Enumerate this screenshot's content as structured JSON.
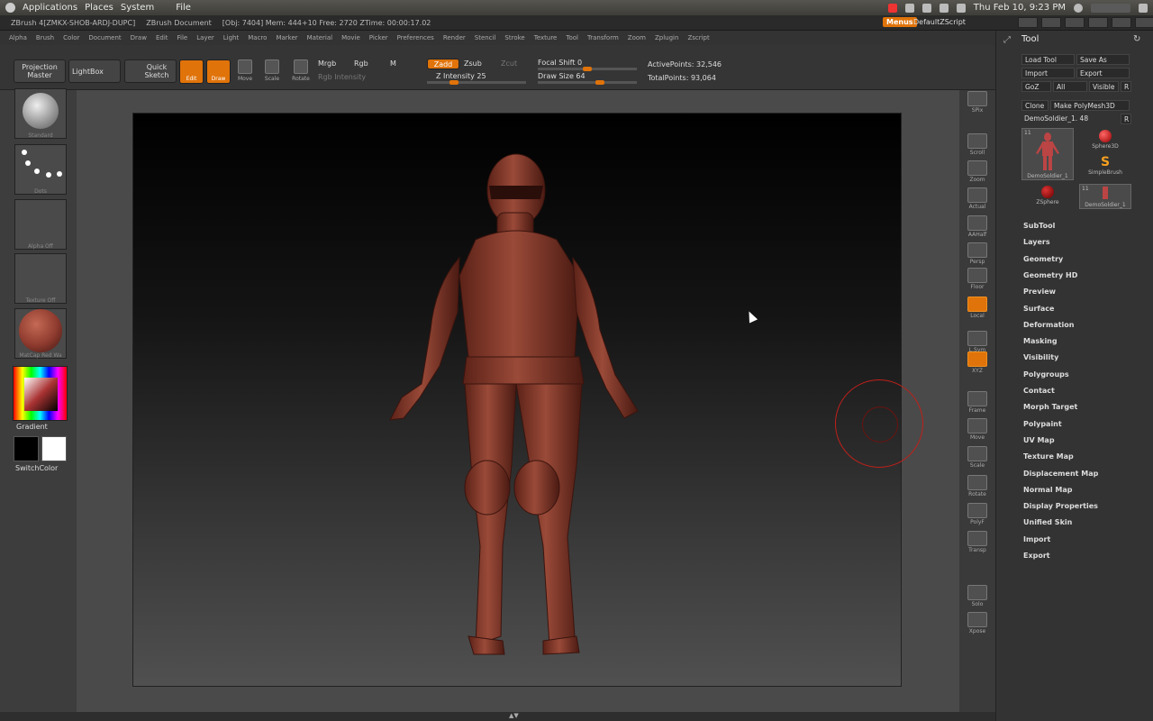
{
  "system_bar": {
    "menus": [
      "Applications",
      "Places",
      "System",
      "File"
    ],
    "clock": "Thu Feb 10,  9:23 PM"
  },
  "title_bar": {
    "app": "ZBrush 4[ZMKX-SHOB-ARDJ-DUPC]",
    "document": "ZBrush Document",
    "stats": "[Obj: 7404] Mem: 444+10 Free: 2720 ZTime: 00:00:17.02",
    "menus_button": "Menus",
    "script": "DefaultZScript"
  },
  "menu_items": [
    "Alpha",
    "Brush",
    "Color",
    "Document",
    "Draw",
    "Edit",
    "File",
    "Layer",
    "Light",
    "Macro",
    "Marker",
    "Material",
    "Movie",
    "Picker",
    "Preferences",
    "Render",
    "Stencil",
    "Stroke",
    "Texture",
    "Tool",
    "Transform",
    "Zoom",
    "Zplugin",
    "Zscript"
  ],
  "toolbar": {
    "projection_master": "Projection Master",
    "lightbox": "LightBox",
    "quick_sketch": "Quick Sketch",
    "edit": "Edit",
    "draw": "Draw",
    "move": "Move",
    "scale": "Scale",
    "rotate": "Rotate",
    "mrgb": "Mrgb",
    "rgb": "Rgb",
    "m": "M",
    "zadd": "Zadd",
    "zsub": "Zsub",
    "zcut": "Zcut",
    "rgb_intensity": "Rgb Intensity",
    "z_intensity": "Z Intensity 25",
    "focal_shift": "Focal Shift 0",
    "draw_size": "Draw Size 64",
    "active_points": "ActivePoints: 32,546",
    "total_points": "TotalPoints: 93,064"
  },
  "left_shelf": {
    "brush": "Standard",
    "stroke": "Dots",
    "alpha": "Alpha Off",
    "texture": "Texture Off",
    "material": "MatCap Red Wa",
    "gradient": "Gradient",
    "switch_color": "SwitchColor"
  },
  "right_shelf": [
    "SPix",
    "Scroll",
    "Zoom",
    "Actual",
    "AAHalf",
    "Persp",
    "Floor",
    "Local",
    "L.Sym",
    "XYZ",
    "Frame",
    "Move",
    "Scale",
    "Rotate",
    "PolyF",
    "Transp",
    "Solo",
    "Xpose"
  ],
  "tool_palette": {
    "title": "Tool",
    "buttons": [
      "Load Tool",
      "Save As",
      "Import",
      "Export",
      "GoZ",
      "All",
      "Visible",
      "R",
      "Clone",
      "Make PolyMesh3D"
    ],
    "current_tool": "DemoSoldier_1. 48",
    "thumbs": [
      "DemoSoldier_1",
      "Sphere3D",
      "SimpleBrush",
      "ZSphere",
      "DemoSoldier_1"
    ],
    "thumb_counts": [
      "11",
      "11"
    ],
    "subpalettes": [
      "SubTool",
      "Layers",
      "Geometry",
      "Geometry HD",
      "Preview",
      "Surface",
      "Deformation",
      "Masking",
      "Visibility",
      "Polygroups",
      "Contact",
      "Morph Target",
      "Polypaint",
      "UV Map",
      "Texture Map",
      "Displacement Map",
      "Normal Map",
      "Display Properties",
      "Unified Skin",
      "Import",
      "Export"
    ]
  },
  "colors": {
    "accent": "#e0730a",
    "model": "#8e3a2e",
    "brush_ring": "#c0201a"
  },
  "sliders": {
    "z_intensity": 0.25,
    "draw_size": 0.64,
    "focal_shift": 0.5
  }
}
